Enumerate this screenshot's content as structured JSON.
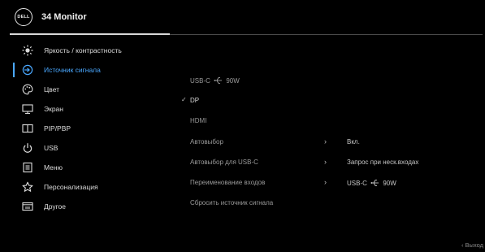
{
  "header": {
    "logo_text": "DELL",
    "title": "34 Monitor"
  },
  "sidebar": {
    "items": [
      {
        "label": "Яркость / контрастность",
        "icon": "brightness-icon"
      },
      {
        "label": "Источник сигнала",
        "icon": "input-source-icon",
        "active": true
      },
      {
        "label": "Цвет",
        "icon": "palette-icon"
      },
      {
        "label": "Экран",
        "icon": "display-icon"
      },
      {
        "label": "PIP/PBP",
        "icon": "pip-pbp-icon"
      },
      {
        "label": "USB",
        "icon": "usb-icon"
      },
      {
        "label": "Меню",
        "icon": "menu-icon"
      },
      {
        "label": "Персонализация",
        "icon": "star-icon"
      },
      {
        "label": "Другое",
        "icon": "other-icon"
      }
    ]
  },
  "main": {
    "usbc_prefix": "USB-C",
    "usbc_suffix": "90W",
    "dp": "DP",
    "hdmi": "HDMI",
    "auto_select": {
      "label": "Автовыбор",
      "value": "Вкл."
    },
    "auto_select_usbc": {
      "label": "Автовыбор для USB-C",
      "value": "Запрос при неск.входах"
    },
    "rename_inputs": {
      "label": "Переименование входов",
      "value_prefix": "USB-C",
      "value_suffix": "90W"
    },
    "reset": "Сбросить источник сигнала",
    "check_mark": "✓",
    "arrow": "›"
  },
  "footer": {
    "exit": "‹ Выход"
  },
  "colors": {
    "accent": "#4aa8ff",
    "background": "#000000"
  }
}
